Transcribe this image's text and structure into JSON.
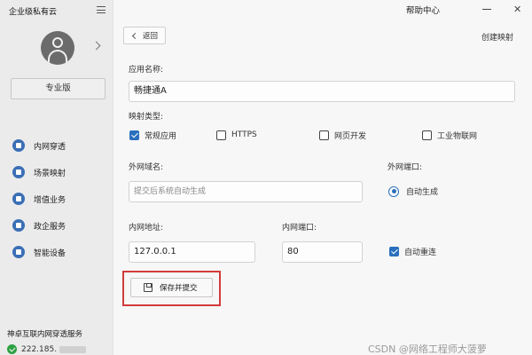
{
  "sidebar": {
    "brand": "企业级私有云",
    "edition": "专业版",
    "nav": [
      {
        "label": "内网穿透",
        "icon": "network-tunnel-icon"
      },
      {
        "label": "场景映射",
        "icon": "scene-mapping-icon"
      },
      {
        "label": "增值业务",
        "icon": "value-added-icon"
      },
      {
        "label": "政企服务",
        "icon": "gov-enterprise-icon"
      },
      {
        "label": "智能设备",
        "icon": "smart-device-icon"
      }
    ],
    "footer_title": "神卓互联内网穿透服务",
    "ip": "222.185."
  },
  "header": {
    "help": "帮助中心",
    "back": "返回",
    "create_mapping": "创建映射"
  },
  "form": {
    "app_name_label": "应用名称:",
    "app_name_value": "畅捷通A",
    "map_type_label": "映射类型:",
    "map_types": [
      {
        "label": "常规应用",
        "checked": true
      },
      {
        "label": "HTTPS",
        "checked": false
      },
      {
        "label": "网页开发",
        "checked": false
      },
      {
        "label": "工业物联网",
        "checked": false
      }
    ],
    "ext_domain_label": "外网域名:",
    "ext_domain_placeholder": "提交后系统自动生成",
    "ext_port_label": "外网端口:",
    "ext_port_option": "自动生成",
    "int_addr_label": "内网地址:",
    "int_addr_value": "127.0.0.1",
    "int_port_label": "内网端口:",
    "int_port_value": "80",
    "auto_reconnect": "自动重连",
    "auto_reconnect_checked": true,
    "save_label": "保存并提交"
  },
  "watermark": "CSDN @网络工程师大菠萝",
  "colors": {
    "accent": "#2a6fbd",
    "highlight": "#d23b3b",
    "status": "#2ea043"
  }
}
